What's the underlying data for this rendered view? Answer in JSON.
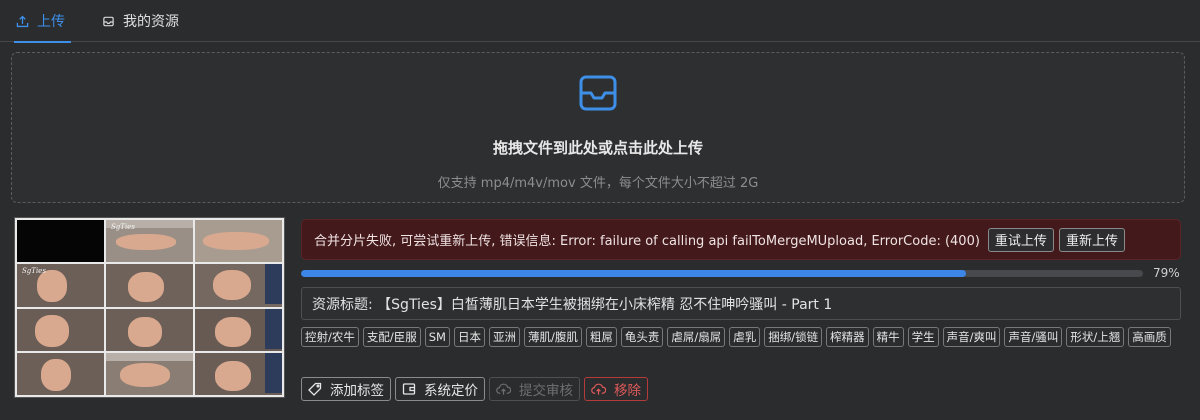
{
  "tabs": [
    {
      "label": "上传",
      "icon": "upload-icon",
      "active": true
    },
    {
      "label": "我的资源",
      "icon": "inbox-icon",
      "active": false
    }
  ],
  "dropzone": {
    "icon": "inbox-icon",
    "title": "拖拽文件到此处或点击此处上传",
    "hint": "仅支持 mp4/m4v/mov 文件，每个文件大小不超过 2G"
  },
  "thumbnail": {
    "watermark": "SgTies"
  },
  "error": {
    "message": "合并分片失败, 可尝试重新上传, 错误信息: Error: failure of calling api failToMergeMUpload, ErrorCode: (400)",
    "retry_label": "重试上传",
    "reupload_label": "重新上传"
  },
  "progress": {
    "percent": 79,
    "label": "79%"
  },
  "resource": {
    "title": "资源标题: 【SgTies】白皙薄肌日本学生被捆绑在小床榨精 忍不住呻吟骚叫 - Part 1"
  },
  "tags": [
    "控射/农牛",
    "支配/臣服",
    "SM",
    "日本",
    "亚洲",
    "薄肌/腹肌",
    "粗屌",
    "龟头责",
    "虐屌/扇屌",
    "虐乳",
    "捆绑/锁链",
    "榨精器",
    "精牛",
    "学生",
    "声音/爽叫",
    "声音/骚叫",
    "形状/上翘",
    "高画质"
  ],
  "actions": {
    "add_tag": "添加标签",
    "pricing": "系统定价",
    "submit": "提交审核",
    "remove": "移除"
  },
  "colors": {
    "accent": "#3d8fe8",
    "error_bg": "#44191b",
    "danger": "#e05a5a",
    "background": "#2b2c2e"
  }
}
